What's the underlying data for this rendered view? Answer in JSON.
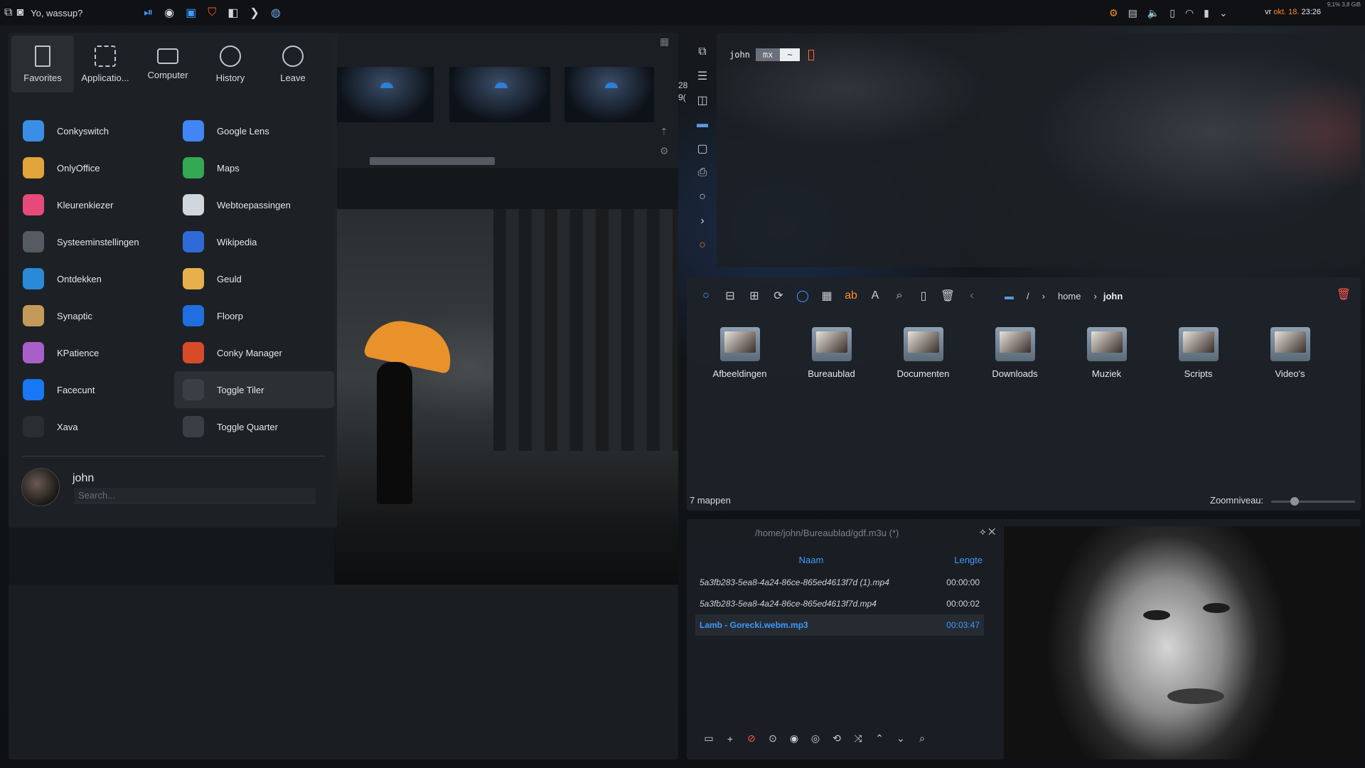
{
  "topbar": {
    "greeting": "Yo, wassup?",
    "clock_prefix": "vr",
    "clock_month": "okt. 18.",
    "clock_time": "23:26",
    "sysinfo": "9,1% 3,8 GiB"
  },
  "launcher": {
    "tabs": [
      {
        "label": "Favorites",
        "icon": "bookmark-icon"
      },
      {
        "label": "Applicatio...",
        "icon": "grid-icon"
      },
      {
        "label": "Computer",
        "icon": "monitor-icon"
      },
      {
        "label": "History",
        "icon": "clock-icon"
      },
      {
        "label": "Leave",
        "icon": "back-arrow-icon"
      }
    ],
    "apps": [
      {
        "name": "Conkyswitch",
        "color": "#3a8ee6"
      },
      {
        "name": "Google Lens",
        "color": "#4285f4"
      },
      {
        "name": "OnlyOffice",
        "color": "#e0a43a"
      },
      {
        "name": "Maps",
        "color": "#34a853"
      },
      {
        "name": "Kleurenkiezer",
        "color": "#e64a7b"
      },
      {
        "name": "Webtoepassingen",
        "color": "#cfd6de"
      },
      {
        "name": "Systeeminstellingen",
        "color": "#555b62"
      },
      {
        "name": "Wikipedia",
        "color": "#2f6bd6"
      },
      {
        "name": "Ontdekken",
        "color": "#2a8ad8"
      },
      {
        "name": "Geuld",
        "color": "#e8b04c"
      },
      {
        "name": "Synaptic",
        "color": "#c49a5a"
      },
      {
        "name": "Floorp",
        "color": "#1f6fe0"
      },
      {
        "name": "KPatience",
        "color": "#a860c8"
      },
      {
        "name": "Conky Manager",
        "color": "#d84b2a"
      },
      {
        "name": "Facecunt",
        "color": "#1877f2"
      },
      {
        "name": "Toggle Tiler",
        "color": "#3a3f45"
      },
      {
        "name": "Xava",
        "color": "#2a2e33"
      },
      {
        "name": "Toggle Quarter",
        "color": "#3a3f45"
      }
    ],
    "user": "john",
    "search_placeholder": "Search..."
  },
  "viewer": {
    "side_numbers": [
      "28",
      "9("
    ]
  },
  "terminal": {
    "user": "john",
    "host": "mx",
    "dir": "~"
  },
  "filemanager": {
    "breadcrumb": [
      "/",
      "home",
      "john"
    ],
    "folders": [
      "Afbeeldingen",
      "Bureaublad",
      "Documenten",
      "Downloads",
      "Muziek",
      "Scripts",
      "Video's"
    ],
    "status": "7 mappen",
    "zoom_label": "Zoomniveau:",
    "zoom_level": 0.25
  },
  "player": {
    "title": "/home/john/Bureaublad/gdf.m3u (*)",
    "col_name": "Naam",
    "col_length": "Lengte",
    "tracks": [
      {
        "name": "5a3fb283-5ea8-4a24-86ce-865ed4613f7d (1).mp4",
        "length": "00:00:00"
      },
      {
        "name": "5a3fb283-5ea8-4a24-86ce-865ed4613f7d.mp4",
        "length": "00:00:02"
      },
      {
        "name": "Lamb - Gorecki.webm.mp3",
        "length": "00:03:47",
        "current": true
      }
    ]
  },
  "colors": {
    "accent": "#3d9bff",
    "umbrella": "#e9912b",
    "warning": "#ff5555"
  }
}
